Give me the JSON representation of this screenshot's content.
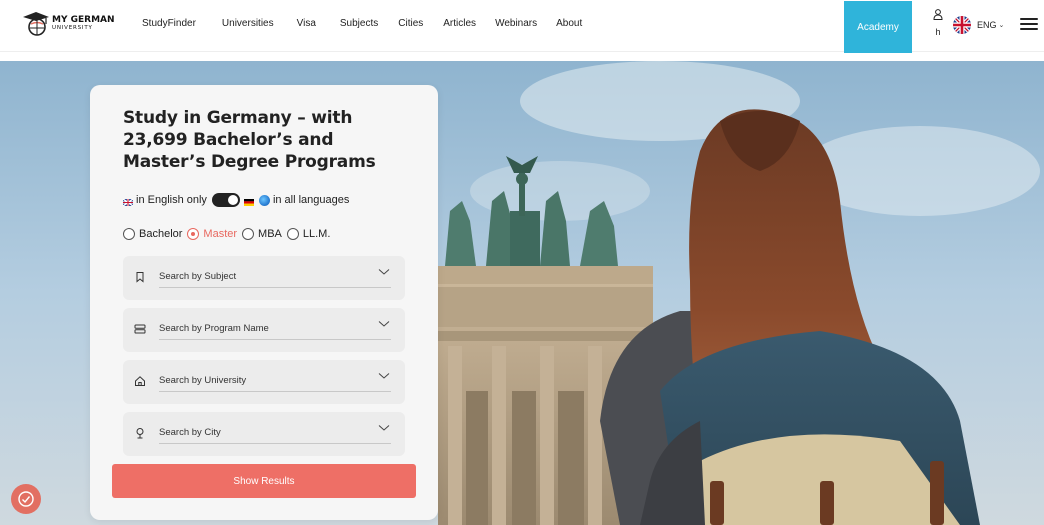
{
  "brand": {
    "line1": "MY GERMAN",
    "line2": "UNIVERSITY"
  },
  "nav": [
    {
      "label": "StudyFinder"
    },
    {
      "label": "Universities"
    },
    {
      "label": "Visa"
    },
    {
      "label": "Subjects"
    },
    {
      "label": "Cities"
    },
    {
      "label": "Articles"
    },
    {
      "label": "Webinars"
    },
    {
      "label": "About"
    }
  ],
  "header": {
    "academy_label": "Academy",
    "user_label": "h",
    "language_code": "ENG"
  },
  "search": {
    "title": "Study in Germany – with 23,699 Bachelor’s and Master’s Degree Programs",
    "english_only_label": "in English only",
    "all_languages_label": "in all languages",
    "degrees": [
      {
        "label": "Bachelor",
        "selected": false
      },
      {
        "label": "Master",
        "selected": true
      },
      {
        "label": "MBA",
        "selected": false
      },
      {
        "label": "LL.M.",
        "selected": false
      }
    ],
    "fields": [
      {
        "placeholder": "Search by Subject",
        "icon": "bookmark-icon"
      },
      {
        "placeholder": "Search by Program Name",
        "icon": "list-icon"
      },
      {
        "placeholder": "Search by University",
        "icon": "home-icon"
      },
      {
        "placeholder": "Search by City",
        "icon": "location-pin-icon"
      }
    ],
    "submit_label": "Show Results"
  },
  "colors": {
    "accent": "#ee6f66",
    "academy": "#2fb4da",
    "radio_selected": "#e8685f"
  }
}
